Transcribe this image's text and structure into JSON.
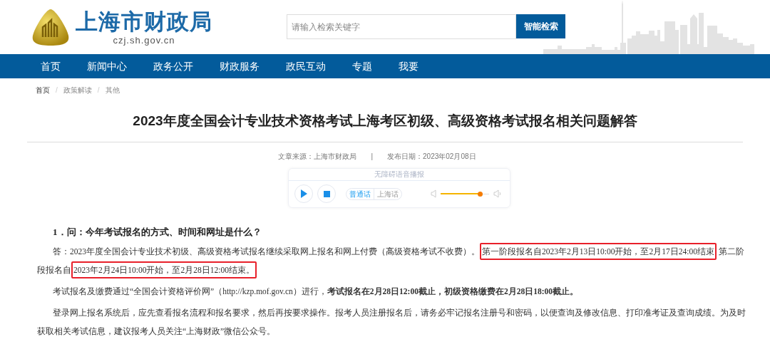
{
  "header": {
    "site_name": "上海市财政局",
    "domain": "czj.sh.gov.cn",
    "search": {
      "placeholder": "请输入检索关键字"
    },
    "search_button": "智能检索"
  },
  "nav": {
    "items": [
      {
        "label": "首页"
      },
      {
        "label": "新闻中心"
      },
      {
        "label": "政务公开"
      },
      {
        "label": "财政服务"
      },
      {
        "label": "政民互动"
      },
      {
        "label": "专题"
      },
      {
        "label": "我要"
      }
    ]
  },
  "breadcrumb": [
    {
      "label": "首页"
    },
    {
      "separator": "/",
      "label": "政策解读"
    },
    {
      "separator": "/",
      "label": "其他"
    }
  ],
  "article": {
    "title": "2023年度全国会计专业技术资格考试上海考区初级、高级资格考试报名相关问题解答",
    "source": "文章来源：上海市财政局",
    "separator": "|",
    "date": "发布日期：2023年02月08日"
  },
  "audio_player": {
    "title": "无障碍语音播报",
    "dialects": [
      {
        "label": "普通话",
        "selected": true
      },
      {
        "label": "上海话",
        "selected": false
      }
    ],
    "volume": {
      "level": 0.82
    }
  },
  "question": "1．问：今年考试报名的方式、时间和网址是什么？",
  "paragraphs": [
    {
      "segments": [
        {
          "text": "答：2023年度全国会计专业技术初级、高级资格考试报名继续采取网上报名和网上付费（高级资格考试不收费）。",
          "highlighted": false
        },
        {
          "text": "第一阶段报名自2023年2月13日10:00开始，至2月17日24:00结束",
          "highlighted": true
        },
        {
          "text": " 第二阶段报名自",
          "highlighted": false
        },
        {
          "text": "2023年2月24日10:00开始，至2月28日12:00结束。",
          "highlighted": true
        }
      ]
    },
    {
      "segments": [
        {
          "text": "考试报名及缴费通过“全国会计资格评价网”（http://kzp.mof.gov.cn）进行，**考试报名在2月28日12:00截止，初级资格缴费在2月28日18:00截止。**",
          "highlighted": false
        }
      ]
    },
    {
      "segments": [
        {
          "text": "登录网上报名系统后，应先查看报名流程和报名要求，然后再按要求操作。报考人员注册报名后，请务必牢记报名注册号和密码，以便查询及修改信息、打印准考证及查询成绩。为及时获取相关考试信息，建议报考人员关注“上海财政”微信公众号。",
          "highlighted": false
        }
      ]
    }
  ]
}
